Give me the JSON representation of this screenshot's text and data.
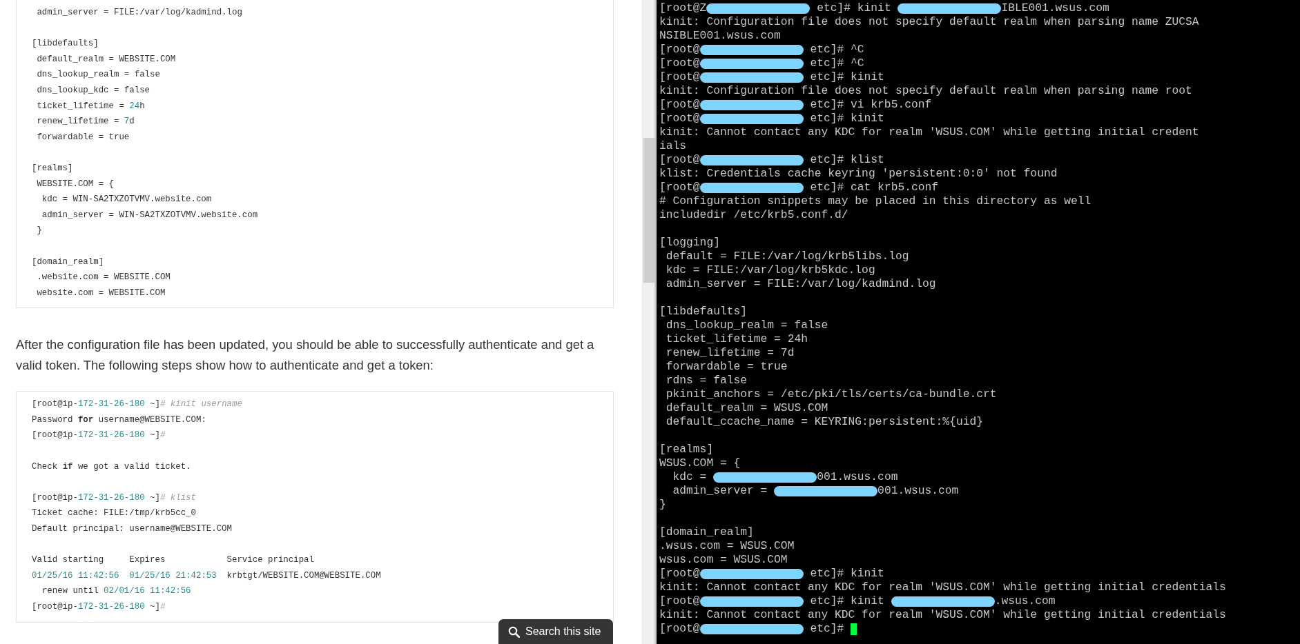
{
  "article": {
    "config_block": {
      "sections": [
        [
          {
            "parts": [
              {
                "kind": "plain",
                "text": " admin_server = FILE:/var/log/kadmind.log"
              }
            ]
          }
        ],
        [
          {
            "parts": [
              {
                "kind": "plain",
                "text": "[libdefaults]"
              }
            ]
          },
          {
            "parts": [
              {
                "kind": "plain",
                "text": " default_realm = WEBSITE.COM"
              }
            ]
          },
          {
            "parts": [
              {
                "kind": "plain",
                "text": " dns_lookup_realm = false"
              }
            ]
          },
          {
            "parts": [
              {
                "kind": "plain",
                "text": " dns_lookup_kdc = false"
              }
            ]
          },
          {
            "parts": [
              {
                "kind": "plain",
                "text": " ticket_lifetime = "
              },
              {
                "kind": "number",
                "text": "24"
              },
              {
                "kind": "plain",
                "text": "h"
              }
            ]
          },
          {
            "parts": [
              {
                "kind": "plain",
                "text": " renew_lifetime = "
              },
              {
                "kind": "number",
                "text": "7"
              },
              {
                "kind": "plain",
                "text": "d"
              }
            ]
          },
          {
            "parts": [
              {
                "kind": "plain",
                "text": " forwardable = true"
              }
            ]
          }
        ],
        [
          {
            "parts": [
              {
                "kind": "plain",
                "text": "[realms]"
              }
            ]
          },
          {
            "parts": [
              {
                "kind": "plain",
                "text": " WEBSITE.COM = {"
              }
            ]
          },
          {
            "parts": [
              {
                "kind": "plain",
                "text": "  kdc = WIN-SA2TXZOTVMV.website.com"
              }
            ]
          },
          {
            "parts": [
              {
                "kind": "plain",
                "text": "  admin_server = WIN-SA2TXZOTVMV.website.com"
              }
            ]
          },
          {
            "parts": [
              {
                "kind": "plain",
                "text": " }"
              }
            ]
          }
        ],
        [
          {
            "parts": [
              {
                "kind": "plain",
                "text": "[domain_realm]"
              }
            ]
          },
          {
            "parts": [
              {
                "kind": "plain",
                "text": " .website.com = WEBSITE.COM"
              }
            ]
          },
          {
            "parts": [
              {
                "kind": "plain",
                "text": " website.com = WEBSITE.COM"
              }
            ]
          }
        ]
      ]
    },
    "paragraph": "After the configuration file has been updated, you should be able to successfully authenticate and get a valid token. The following steps show how to authenticate and get a token:",
    "shell_block": {
      "sections": [
        [
          {
            "parts": [
              {
                "kind": "plain",
                "text": "[root@ip-"
              },
              {
                "kind": "number",
                "text": "172-31-26-180"
              },
              {
                "kind": "plain",
                "text": " ~]"
              },
              {
                "kind": "comment",
                "text": "# kinit username"
              }
            ]
          },
          {
            "parts": [
              {
                "kind": "plain",
                "text": "Password "
              },
              {
                "kind": "keyword",
                "text": "for"
              },
              {
                "kind": "plain",
                "text": " username@WEBSITE.COM:"
              }
            ]
          },
          {
            "parts": [
              {
                "kind": "plain",
                "text": "[root@ip-"
              },
              {
                "kind": "number",
                "text": "172-31-26-180"
              },
              {
                "kind": "plain",
                "text": " ~]"
              },
              {
                "kind": "comment",
                "text": "#"
              }
            ]
          }
        ],
        [
          {
            "parts": [
              {
                "kind": "plain",
                "text": "Check "
              },
              {
                "kind": "keyword",
                "text": "if"
              },
              {
                "kind": "plain",
                "text": " we got a valid ticket."
              }
            ]
          }
        ],
        [
          {
            "parts": [
              {
                "kind": "plain",
                "text": "[root@ip-"
              },
              {
                "kind": "number",
                "text": "172-31-26-180"
              },
              {
                "kind": "plain",
                "text": " ~]"
              },
              {
                "kind": "comment",
                "text": "# klist"
              }
            ]
          },
          {
            "parts": [
              {
                "kind": "plain",
                "text": "Ticket cache: FILE:/tmp/krb5cc_0"
              }
            ]
          },
          {
            "parts": [
              {
                "kind": "plain",
                "text": "Default principal: username@WEBSITE.COM"
              }
            ]
          }
        ],
        [
          {
            "parts": [
              {
                "kind": "plain",
                "text": "Valid starting     Expires            Service principal"
              }
            ]
          },
          {
            "parts": [
              {
                "kind": "number",
                "text": "01/25/16 11:42:56"
              },
              {
                "kind": "number",
                "text": "  01/25/16 21:42:53"
              },
              {
                "kind": "plain",
                "text": "  krbtgt/WEBSITE.COM@WEBSITE.COM"
              }
            ]
          },
          {
            "parts": [
              {
                "kind": "plain",
                "text": "  renew until "
              },
              {
                "kind": "number",
                "text": "02/01/16 11:42:56"
              }
            ]
          },
          {
            "parts": [
              {
                "kind": "plain",
                "text": "[root@ip-"
              },
              {
                "kind": "number",
                "text": "172-31-26-180"
              },
              {
                "kind": "plain",
                "text": " ~]"
              },
              {
                "kind": "comment",
                "text": "#"
              }
            ]
          }
        ]
      ]
    }
  },
  "search_button": {
    "label": "Search this site"
  },
  "terminal": {
    "sections": [
      [
        {
          "parts": [
            {
              "kind": "text",
              "text": "[root@Z"
            },
            {
              "kind": "redaction"
            },
            {
              "kind": "text",
              "text": " etc]# kinit "
            },
            {
              "kind": "redaction"
            },
            {
              "kind": "text",
              "text": "IBLE001.wsus.com"
            }
          ]
        },
        {
          "parts": [
            {
              "kind": "text",
              "text": "kinit: Configuration file does not specify default realm when parsing name ZUCSA"
            }
          ]
        },
        {
          "parts": [
            {
              "kind": "text",
              "text": "NSIBLE001.wsus.com"
            }
          ]
        },
        {
          "parts": [
            {
              "kind": "text",
              "text": "[root@"
            },
            {
              "kind": "redaction"
            },
            {
              "kind": "text",
              "text": " etc]# ^C"
            }
          ]
        },
        {
          "parts": [
            {
              "kind": "text",
              "text": "[root@"
            },
            {
              "kind": "redaction"
            },
            {
              "kind": "text",
              "text": " etc]# ^C"
            }
          ]
        },
        {
          "parts": [
            {
              "kind": "text",
              "text": "[root@"
            },
            {
              "kind": "redaction"
            },
            {
              "kind": "text",
              "text": " etc]# kinit"
            }
          ]
        },
        {
          "parts": [
            {
              "kind": "text",
              "text": "kinit: Configuration file does not specify default realm when parsing name root"
            }
          ]
        },
        {
          "parts": [
            {
              "kind": "text",
              "text": "[root@"
            },
            {
              "kind": "redaction"
            },
            {
              "kind": "text",
              "text": " etc]# vi krb5.conf"
            }
          ]
        },
        {
          "parts": [
            {
              "kind": "text",
              "text": "[root@"
            },
            {
              "kind": "redaction"
            },
            {
              "kind": "text",
              "text": " etc]# kinit"
            }
          ]
        },
        {
          "parts": [
            {
              "kind": "text",
              "text": "kinit: Cannot contact any KDC for realm 'WSUS.COM' while getting initial credent"
            }
          ]
        },
        {
          "parts": [
            {
              "kind": "text",
              "text": "ials"
            }
          ]
        },
        {
          "parts": [
            {
              "kind": "text",
              "text": "[root@"
            },
            {
              "kind": "redaction"
            },
            {
              "kind": "text",
              "text": " etc]# klist"
            }
          ]
        },
        {
          "parts": [
            {
              "kind": "text",
              "text": "klist: Credentials cache keyring 'persistent:0:0' not found"
            }
          ]
        },
        {
          "parts": [
            {
              "kind": "text",
              "text": "[root@"
            },
            {
              "kind": "redaction"
            },
            {
              "kind": "text",
              "text": " etc]# cat krb5.conf"
            }
          ]
        },
        {
          "parts": [
            {
              "kind": "text",
              "text": "# Configuration snippets may be placed in this directory as well"
            }
          ]
        },
        {
          "parts": [
            {
              "kind": "text",
              "text": "includedir /etc/krb5.conf.d/"
            }
          ]
        }
      ],
      [
        {
          "parts": [
            {
              "kind": "text",
              "text": "[logging]"
            }
          ]
        },
        {
          "parts": [
            {
              "kind": "text",
              "text": " default = FILE:/var/log/krb5libs.log"
            }
          ]
        },
        {
          "parts": [
            {
              "kind": "text",
              "text": " kdc = FILE:/var/log/krb5kdc.log"
            }
          ]
        },
        {
          "parts": [
            {
              "kind": "text",
              "text": " admin_server = FILE:/var/log/kadmind.log"
            }
          ]
        }
      ],
      [
        {
          "parts": [
            {
              "kind": "text",
              "text": "[libdefaults]"
            }
          ]
        },
        {
          "parts": [
            {
              "kind": "text",
              "text": " dns_lookup_realm = false"
            }
          ]
        },
        {
          "parts": [
            {
              "kind": "text",
              "text": " ticket_lifetime = 24h"
            }
          ]
        },
        {
          "parts": [
            {
              "kind": "text",
              "text": " renew_lifetime = 7d"
            }
          ]
        },
        {
          "parts": [
            {
              "kind": "text",
              "text": " forwardable = true"
            }
          ]
        },
        {
          "parts": [
            {
              "kind": "text",
              "text": " rdns = false"
            }
          ]
        },
        {
          "parts": [
            {
              "kind": "text",
              "text": " pkinit_anchors = /etc/pki/tls/certs/ca-bundle.crt"
            }
          ]
        },
        {
          "parts": [
            {
              "kind": "text",
              "text": " default_realm = WSUS.COM"
            }
          ]
        },
        {
          "parts": [
            {
              "kind": "text",
              "text": " default_ccache_name = KEYRING:persistent:%{uid}"
            }
          ]
        }
      ],
      [
        {
          "parts": [
            {
              "kind": "text",
              "text": "[realms]"
            }
          ]
        },
        {
          "parts": [
            {
              "kind": "text",
              "text": "WSUS.COM = {"
            }
          ]
        },
        {
          "parts": [
            {
              "kind": "text",
              "text": "  kdc = "
            },
            {
              "kind": "redaction"
            },
            {
              "kind": "text",
              "text": "001.wsus.com"
            }
          ]
        },
        {
          "parts": [
            {
              "kind": "text",
              "text": "  admin_server = "
            },
            {
              "kind": "redaction"
            },
            {
              "kind": "text",
              "text": "001.wsus.com"
            }
          ]
        },
        {
          "parts": [
            {
              "kind": "text",
              "text": "}"
            }
          ]
        }
      ],
      [
        {
          "parts": [
            {
              "kind": "text",
              "text": "[domain_realm]"
            }
          ]
        },
        {
          "parts": [
            {
              "kind": "text",
              "text": ".wsus.com = WSUS.COM"
            }
          ]
        },
        {
          "parts": [
            {
              "kind": "text",
              "text": "wsus.com = WSUS.COM"
            }
          ]
        },
        {
          "parts": [
            {
              "kind": "text",
              "text": "[root@"
            },
            {
              "kind": "redaction"
            },
            {
              "kind": "text",
              "text": " etc]# kinit"
            }
          ]
        },
        {
          "parts": [
            {
              "kind": "text",
              "text": "kinit: Cannot contact any KDC for realm 'WSUS.COM' while getting initial credentials"
            }
          ]
        },
        {
          "parts": [
            {
              "kind": "text",
              "text": "[root@"
            },
            {
              "kind": "redaction"
            },
            {
              "kind": "text",
              "text": " etc]# kinit "
            },
            {
              "kind": "redaction"
            },
            {
              "kind": "text",
              "text": ".wsus.com"
            }
          ]
        },
        {
          "parts": [
            {
              "kind": "text",
              "text": "kinit: Cannot contact any KDC for realm 'WSUS.COM' while getting initial credentials"
            }
          ]
        },
        {
          "parts": [
            {
              "kind": "text",
              "text": "[root@"
            },
            {
              "kind": "redaction"
            },
            {
              "kind": "text",
              "text": " etc]# "
            },
            {
              "kind": "cursor"
            }
          ]
        }
      ]
    ]
  }
}
